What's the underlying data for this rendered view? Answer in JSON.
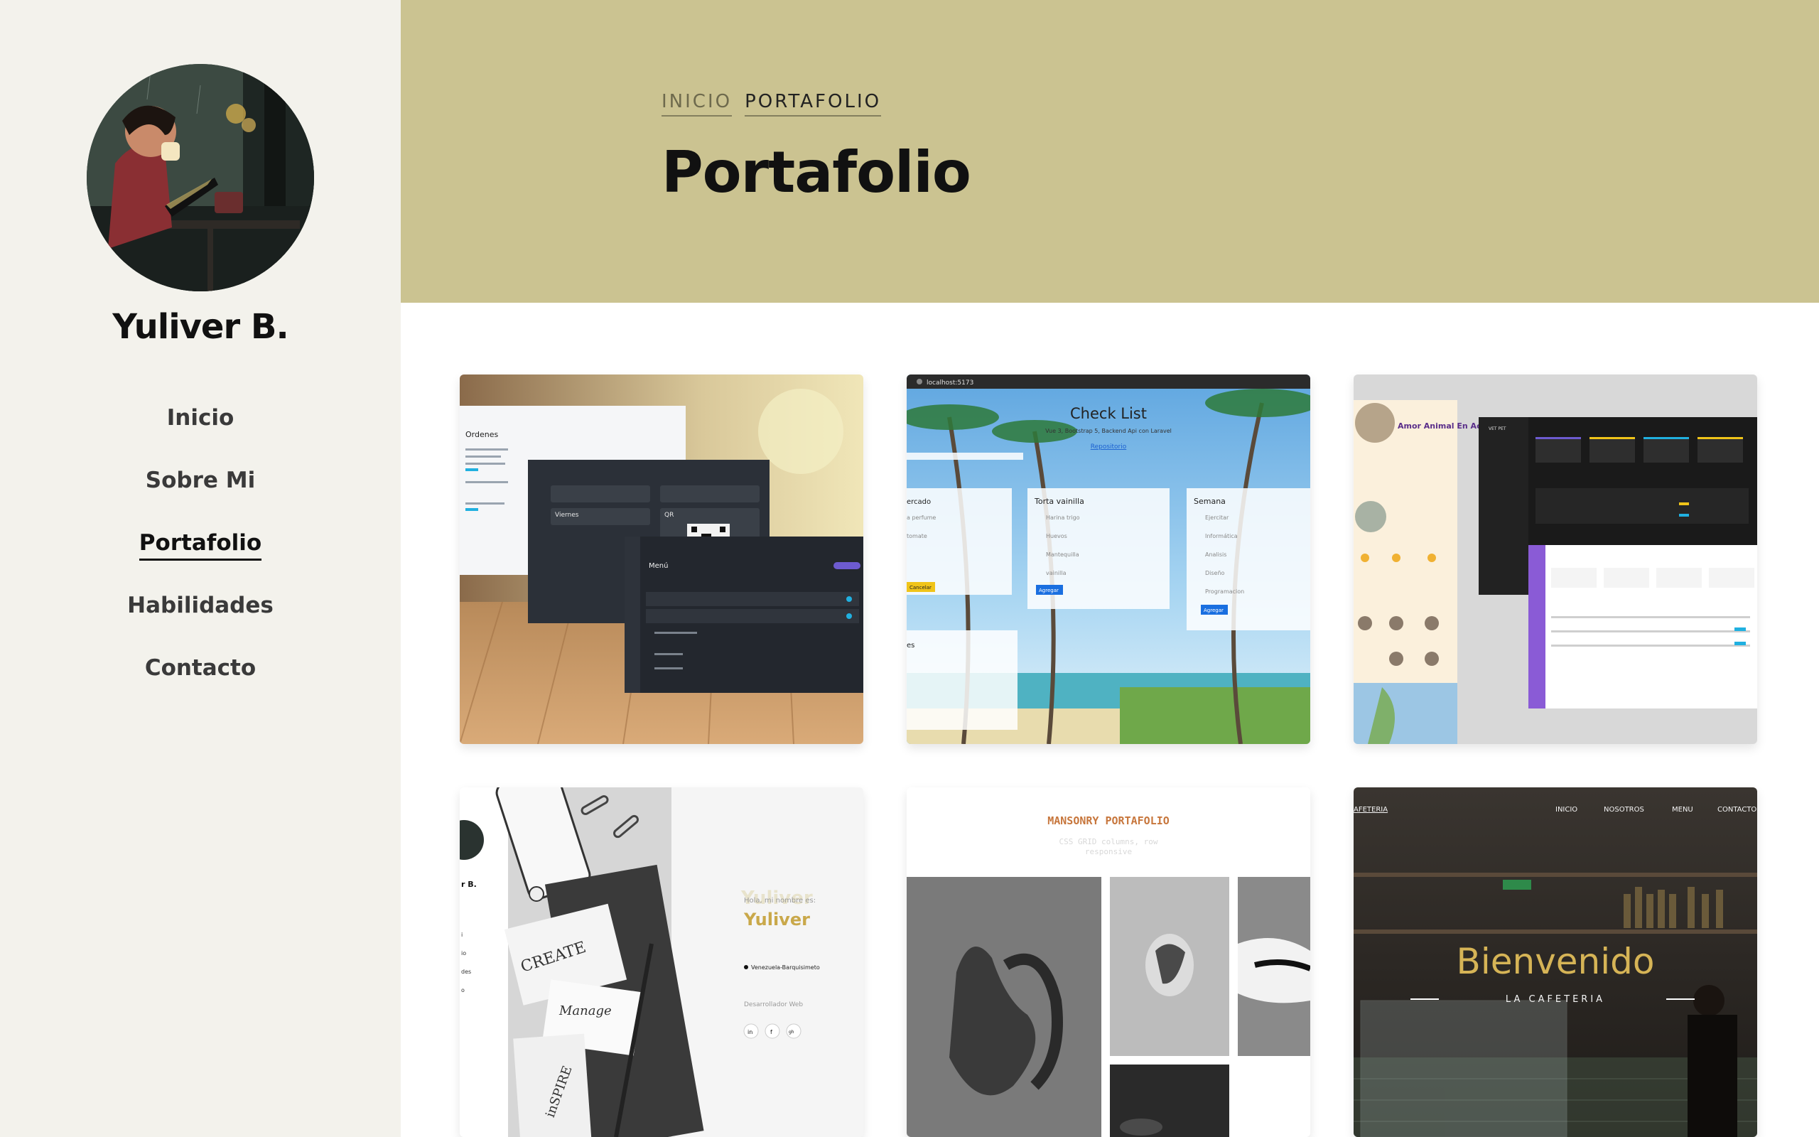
{
  "profile": {
    "name": "Yuliver B."
  },
  "nav": {
    "items": [
      {
        "label": "Inicio"
      },
      {
        "label": "Sobre Mi"
      },
      {
        "label": "Portafolio"
      },
      {
        "label": "Habilidades"
      },
      {
        "label": "Contacto"
      }
    ],
    "active_index": 2
  },
  "header": {
    "breadcrumb": [
      "INICIO",
      "PORTAFOLIO"
    ],
    "title": "Portafolio"
  },
  "projects": [
    {
      "screens": {
        "orders_title": "Ordenes",
        "card_a": "Viernes",
        "card_b": "QR",
        "menu_title": "Menú"
      }
    },
    {
      "browser_url": "localhost:5173",
      "title": "Check List",
      "subtitle": "Vue 3, Bootstrap 5, Backend Api con Laravel",
      "link": "Repositorio",
      "lists": [
        {
          "title": "ercado",
          "items": [
            "a perfume",
            "tomate"
          ],
          "button": "Cancelar"
        },
        {
          "title": "Torta vainilla",
          "items": [
            "Harina trigo",
            "Huevos",
            "Mantequilla",
            "vainilla"
          ],
          "button": "Agregar"
        },
        {
          "title": "Semana",
          "items": [
            "Ejercitar",
            "Informática",
            "Analisis",
            "Diseño",
            "Programacion"
          ],
          "button": "Agregar"
        }
      ],
      "lower_list_title": "es"
    },
    {
      "landing_title": "Amor Animal En Acción",
      "dashboard_brand": "VET PET"
    },
    {
      "side_name": "r B.",
      "side_items": [
        "i",
        "io",
        "des",
        "o"
      ],
      "paper_words": [
        "CREATE",
        "Manage",
        "inSPIRE"
      ],
      "greeting": "Hola, mi nombre es:",
      "ghost_name": "Yuliver",
      "name": "Yuliver",
      "location": "Venezuela-Barquisimeto",
      "role": "Desarrollador Web",
      "social": [
        "in",
        "f",
        "gh"
      ]
    },
    {
      "title": "MANSONRY PORTAFOLIO",
      "subtitle_1": "CSS GRID columns, row",
      "subtitle_2": "responsive"
    },
    {
      "brand": "AFETERIA",
      "menu": [
        "INICIO",
        "NOSOTROS",
        "MENU",
        "CONTACTO"
      ],
      "headline": "Bienvenido",
      "tagline": "LA CAFETERIA"
    }
  ],
  "colors": {
    "sidebar_bg": "#f3f2ec",
    "header_bg": "#cbc391",
    "accent_gold": "#c9a84a",
    "text_dark": "#111111"
  }
}
